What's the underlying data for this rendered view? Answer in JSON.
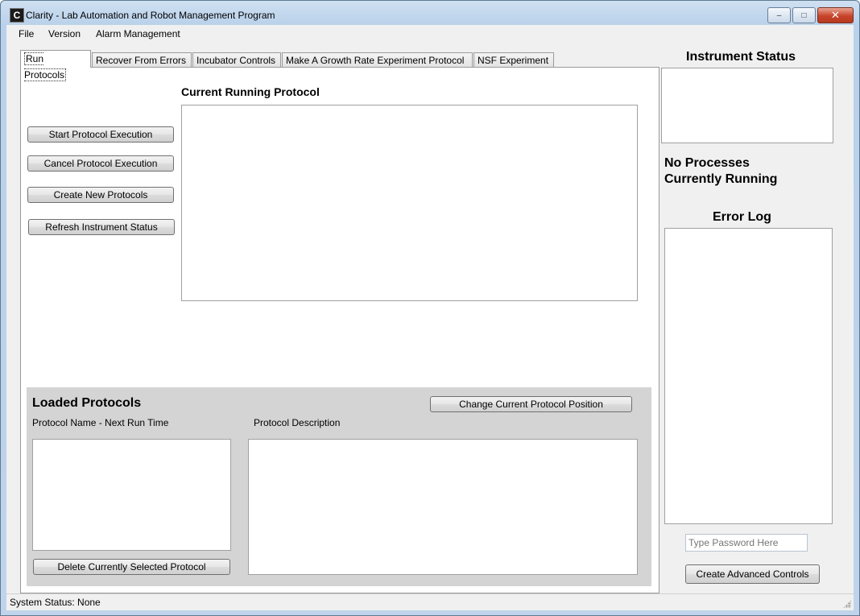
{
  "window": {
    "app_icon_letter": "C",
    "title": "Clarity - Lab Automation and  Robot Management Program",
    "minimize_glyph": "–",
    "maximize_glyph": "□",
    "close_glyph": "✕"
  },
  "menu": {
    "items": [
      "File",
      "Version",
      "Alarm Management"
    ]
  },
  "tabs": [
    {
      "label": "Run Protocols",
      "active": true
    },
    {
      "label": "Recover From Errors"
    },
    {
      "label": "Incubator Controls"
    },
    {
      "label": "Make A Growth Rate Experiment Protocol"
    },
    {
      "label": "NSF Experiment"
    }
  ],
  "run_protocols": {
    "current_running_label": "Current Running Protocol",
    "buttons": {
      "start": "Start Protocol Execution",
      "cancel": "Cancel Protocol Execution",
      "create_new": "Create New Protocols",
      "refresh": "Refresh Instrument Status"
    },
    "loaded": {
      "title": "Loaded Protocols",
      "change_position_button": "Change Current Protocol Position",
      "name_column_label": "Protocol Name - Next Run Time",
      "description_label": "Protocol Description",
      "delete_button": "Delete Currently Selected Protocol"
    }
  },
  "right_panel": {
    "instrument_status_title": "Instrument Status",
    "processes_line1": "No Processes",
    "processes_line2": "Currently Running",
    "error_log_title": "Error Log",
    "password_placeholder": "Type Password Here",
    "advanced_button": "Create Advanced Controls"
  },
  "statusbar": {
    "text": "System Status: None"
  }
}
